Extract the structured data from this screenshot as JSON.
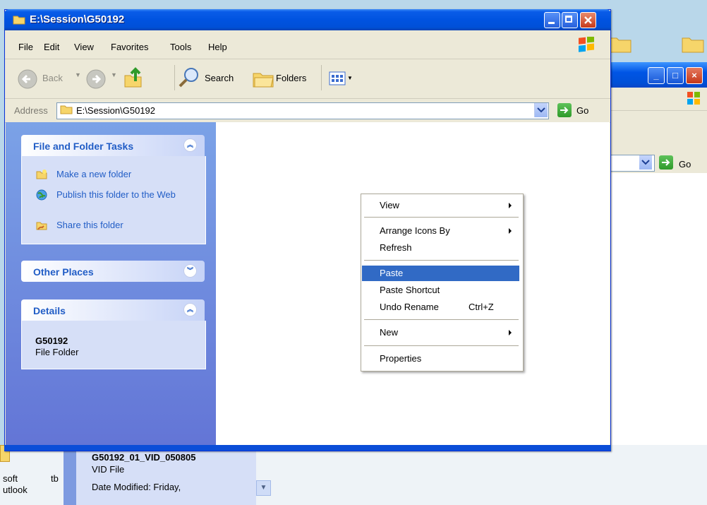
{
  "window": {
    "title": "E:\\Session\\G50192"
  },
  "menu": [
    "File",
    "Edit",
    "View",
    "Favorites",
    "Tools",
    "Help"
  ],
  "toolbar": {
    "back": "Back",
    "search": "Search",
    "folders": "Folders"
  },
  "address": {
    "label": "Address",
    "value": "E:\\Session\\G50192",
    "go": "Go"
  },
  "tasks": {
    "file_folder": {
      "title": "File and Folder Tasks",
      "items": [
        "Make a new folder",
        "Publish this folder to the Web",
        "Share this folder"
      ]
    },
    "other_places": {
      "title": "Other Places"
    },
    "details": {
      "title": "Details",
      "name": "G50192",
      "type": "File Folder"
    }
  },
  "context_menu": {
    "items": [
      {
        "label": "View",
        "submenu": true
      },
      {
        "label": "Arrange Icons By",
        "submenu": true
      },
      {
        "label": "Refresh"
      },
      {
        "label": "Paste",
        "highlighted": true
      },
      {
        "label": "Paste Shortcut"
      },
      {
        "label": "Undo Rename",
        "shortcut": "Ctrl+Z"
      },
      {
        "label": "New",
        "submenu": true
      },
      {
        "label": "Properties"
      }
    ]
  },
  "background_window": {
    "go": "Go"
  },
  "background_details": {
    "name": "G50192_01_VID_050805",
    "type": "VID File",
    "modified": "Date Modified: Friday,"
  },
  "desktop": {
    "label_soft": "soft",
    "label_tb": "tb",
    "label_utlook": "utlook"
  },
  "colors": {
    "titlebar": "#0053e0",
    "taskpane": "#6f8fe0",
    "link": "#215dc6",
    "highlight": "#316ac5"
  }
}
